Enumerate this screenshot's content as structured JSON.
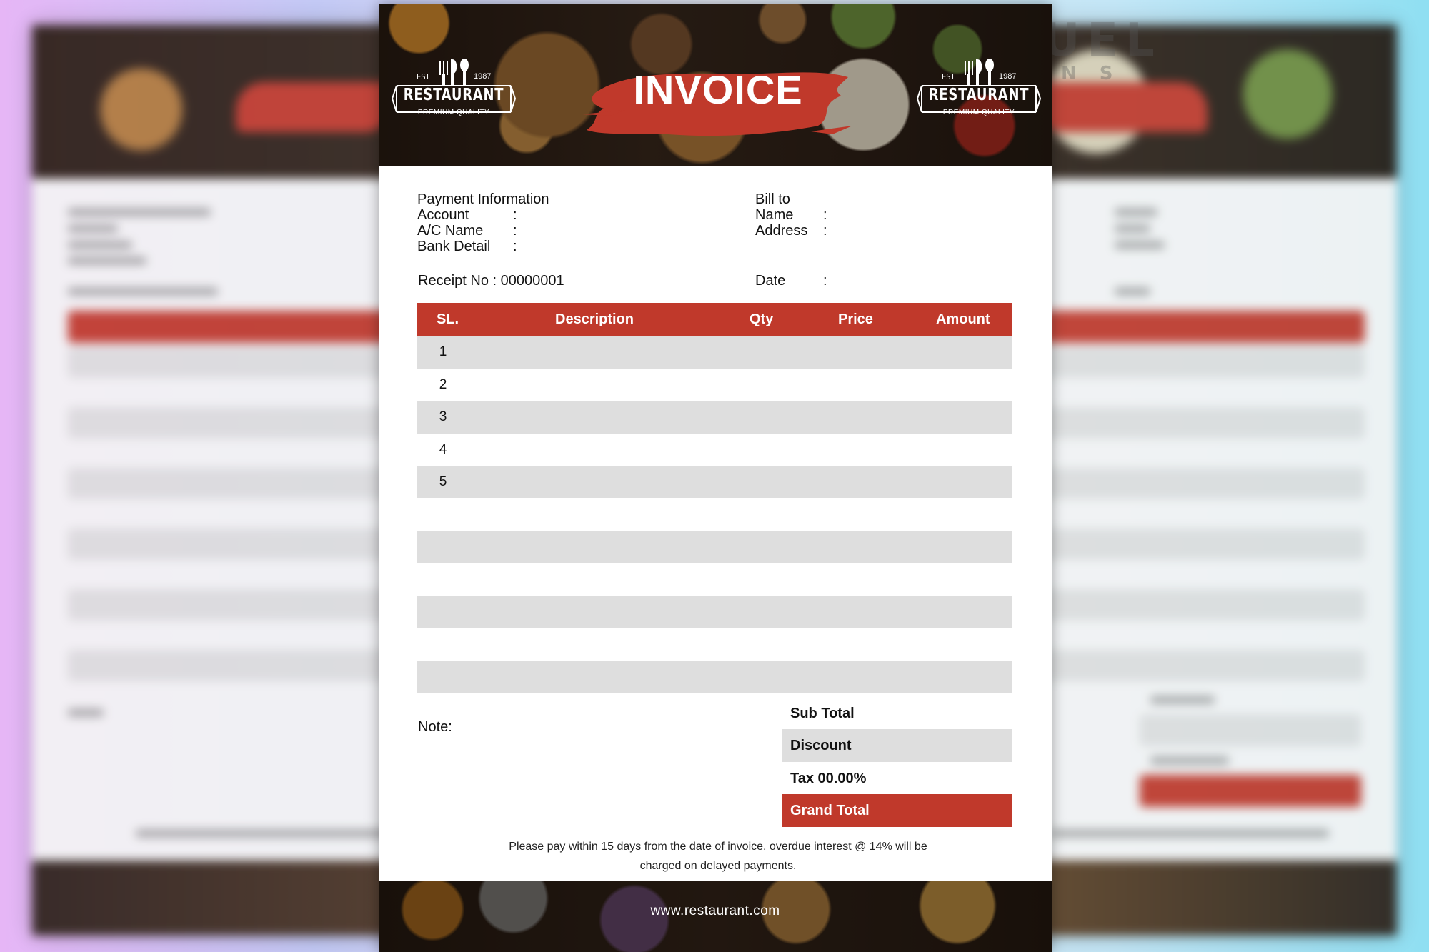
{
  "watermark": {
    "line1": "SAMUEL",
    "line2": "IGNS"
  },
  "header": {
    "title": "INVOICE",
    "logo": {
      "est": "EST",
      "year": "1987",
      "brand": "RESTAURANT",
      "tagline": "PREMIUM QUALITY"
    }
  },
  "payment": {
    "heading": "Payment Information",
    "fields": [
      "Account",
      "A/C Name",
      "Bank Detail"
    ]
  },
  "bill_to": {
    "heading": "Bill to",
    "fields": [
      "Name",
      "Address"
    ]
  },
  "receipt": {
    "label": "Receipt No : 00000001"
  },
  "date": {
    "label": "Date"
  },
  "colon": ":",
  "table": {
    "headers": {
      "sl": "SL.",
      "description": "Description",
      "qty": "Qty",
      "price": "Price",
      "amount": "Amount"
    },
    "rows": [
      "1",
      "2",
      "3",
      "4",
      "5"
    ]
  },
  "note": {
    "label": "Note:"
  },
  "summary": {
    "subtotal": "Sub Total",
    "discount": "Discount",
    "tax": "Tax 00.00%",
    "grand_total": "Grand Total"
  },
  "terms": {
    "line1": "Please pay within 15 days from the date of invoice, overdue interest @ 14% will be",
    "line2": "charged on delayed payments."
  },
  "footer": {
    "website": "www.restaurant.com"
  },
  "colors": {
    "accent": "#c0392b",
    "shade": "#dedede"
  }
}
